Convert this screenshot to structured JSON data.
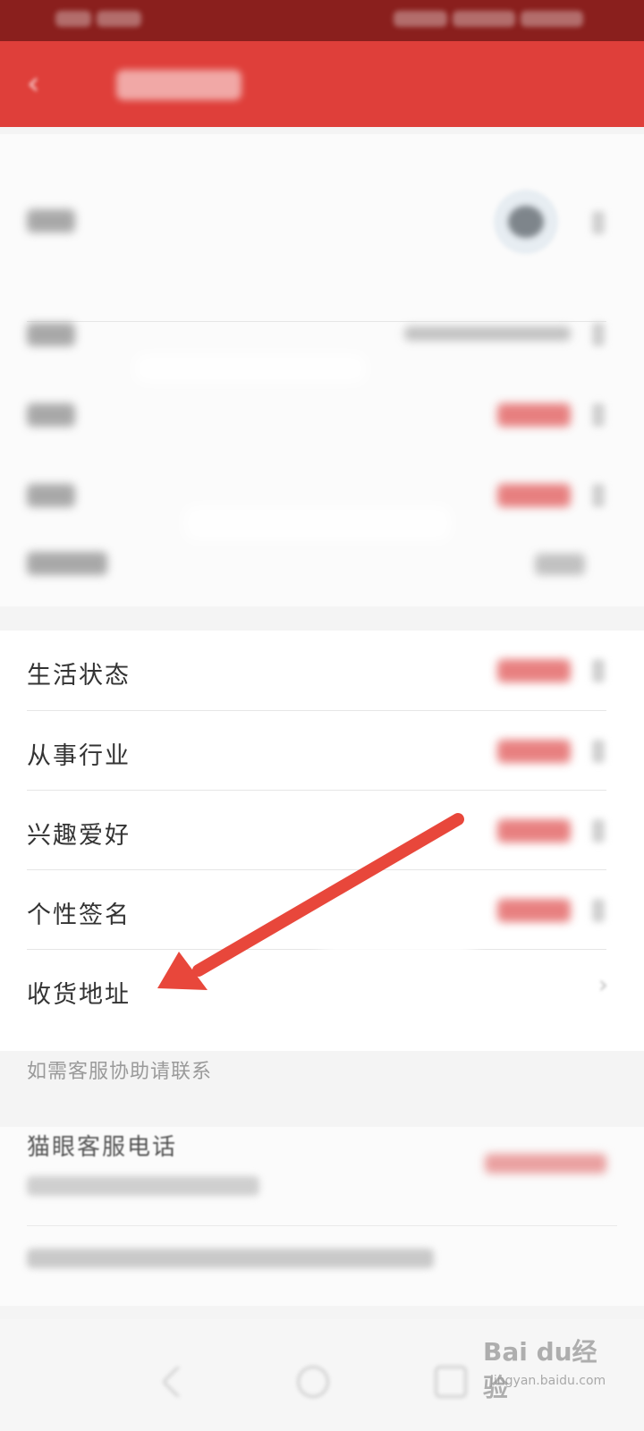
{
  "profile_section_2": {
    "items": [
      {
        "label": "生活状态"
      },
      {
        "label": "从事行业"
      },
      {
        "label": "兴趣爱好"
      },
      {
        "label": "个性签名"
      },
      {
        "label": "收货地址"
      }
    ],
    "chevron": "›"
  },
  "support": {
    "caption": "如需客服协助请联系",
    "title": "猫眼客服电话"
  },
  "watermark": {
    "logo": "Bai du经验",
    "url": "jingyan.baidu.com"
  },
  "colors": {
    "nav_red": "#df3f3a",
    "status_red": "#8a1f1d",
    "annotation_arrow": "#e8473b"
  },
  "icons": [
    "back-icon",
    "chevron-right-icon",
    "nav-back-icon",
    "nav-home-icon",
    "nav-recent-icon",
    "annotation-arrow-icon"
  ]
}
